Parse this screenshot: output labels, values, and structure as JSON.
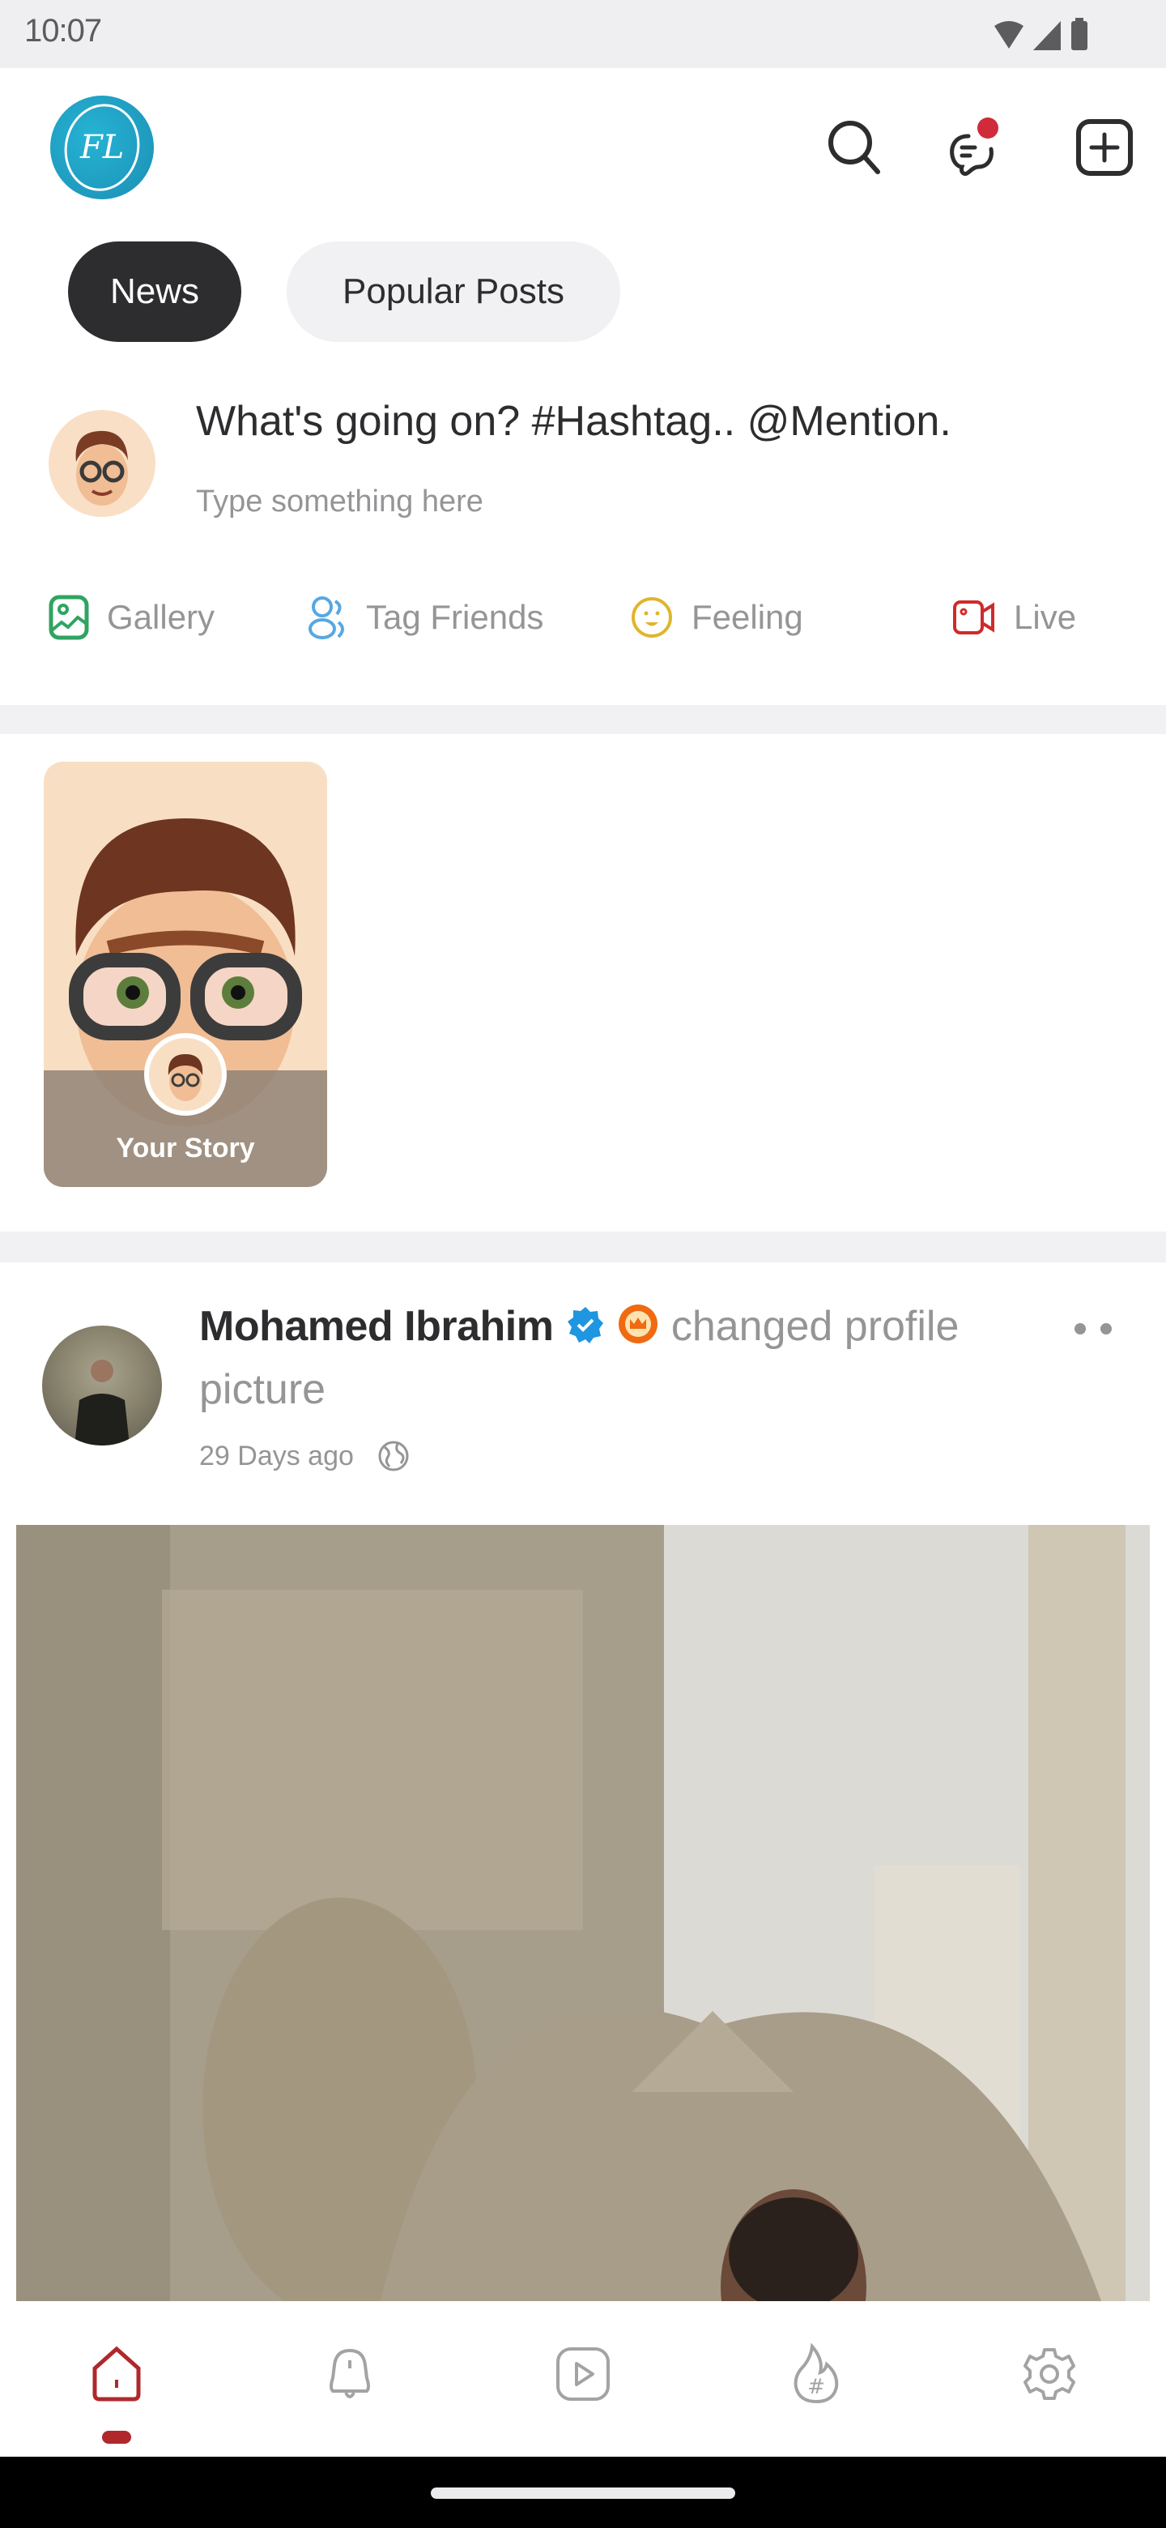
{
  "status_bar": {
    "time": "10:07"
  },
  "header": {
    "logo_text": "FL",
    "icons": [
      "search-icon",
      "messages-icon",
      "create-post-icon"
    ],
    "messages_badge_color": "#cf2b3b"
  },
  "tabs": [
    {
      "label": "News",
      "active": true
    },
    {
      "label": "Popular Posts",
      "active": false
    }
  ],
  "composer": {
    "title": "What's going on? #Hashtag.. @Mention.",
    "placeholder": "Type something here",
    "actions": [
      {
        "label": "Gallery",
        "icon": "gallery-icon",
        "color": "#2fa462"
      },
      {
        "label": "Tag Friends",
        "icon": "tag-friends-icon",
        "color": "#56a8e3"
      },
      {
        "label": "Feeling",
        "icon": "feeling-icon",
        "color": "#e0b52e"
      },
      {
        "label": "Live",
        "icon": "live-video-icon",
        "color": "#cf2b2b"
      }
    ]
  },
  "stories": [
    {
      "label": "Your Story"
    }
  ],
  "post": {
    "author": "Mohamed Ibrahim",
    "verified": true,
    "pro_badge": true,
    "action_text": "changed profile picture",
    "time": "29 Days ago",
    "privacy": "public"
  },
  "bottom_nav": {
    "items": [
      {
        "name": "home",
        "active": true
      },
      {
        "name": "notifications",
        "active": false
      },
      {
        "name": "videos",
        "active": false
      },
      {
        "name": "trending-hashtags",
        "active": false
      },
      {
        "name": "settings",
        "active": false
      }
    ],
    "active_color": "#b0282b",
    "inactive_color": "#a3a3a5"
  }
}
